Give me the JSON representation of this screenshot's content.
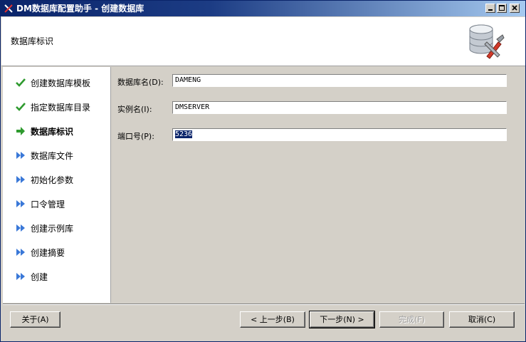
{
  "window": {
    "title": "DM数据库配置助手 - 创建数据库"
  },
  "header": {
    "title": "数据库标识",
    "logo_icon": "database-config-icon"
  },
  "steps": [
    {
      "label": "创建数据库模板",
      "state": "done",
      "icon": "check-icon"
    },
    {
      "label": "指定数据库目录",
      "state": "done",
      "icon": "check-icon"
    },
    {
      "label": "数据库标识",
      "state": "current",
      "icon": "arrow-right-icon"
    },
    {
      "label": "数据库文件",
      "state": "pending",
      "icon": "double-arrow-icon"
    },
    {
      "label": "初始化参数",
      "state": "pending",
      "icon": "double-arrow-icon"
    },
    {
      "label": "口令管理",
      "state": "pending",
      "icon": "double-arrow-icon"
    },
    {
      "label": "创建示例库",
      "state": "pending",
      "icon": "double-arrow-icon"
    },
    {
      "label": "创建摘要",
      "state": "pending",
      "icon": "double-arrow-icon"
    },
    {
      "label": "创建",
      "state": "pending",
      "icon": "double-arrow-icon"
    }
  ],
  "form": {
    "db_name": {
      "label": "数据库名(D):",
      "value": "DAMENG"
    },
    "instance_name": {
      "label": "实例名(I):",
      "value": "DMSERVER"
    },
    "port": {
      "label": "端口号(P):",
      "value": "5236"
    }
  },
  "buttons": {
    "about": "关于(A)",
    "back": "< 上一步(B)",
    "next": "下一步(N) >",
    "finish": "完成(F)",
    "cancel": "取消(C)"
  },
  "colors": {
    "title_start": "#0a246a",
    "title_end": "#a6caf0",
    "done_green": "#2e9a2e",
    "pending_blue": "#3a78d8"
  }
}
